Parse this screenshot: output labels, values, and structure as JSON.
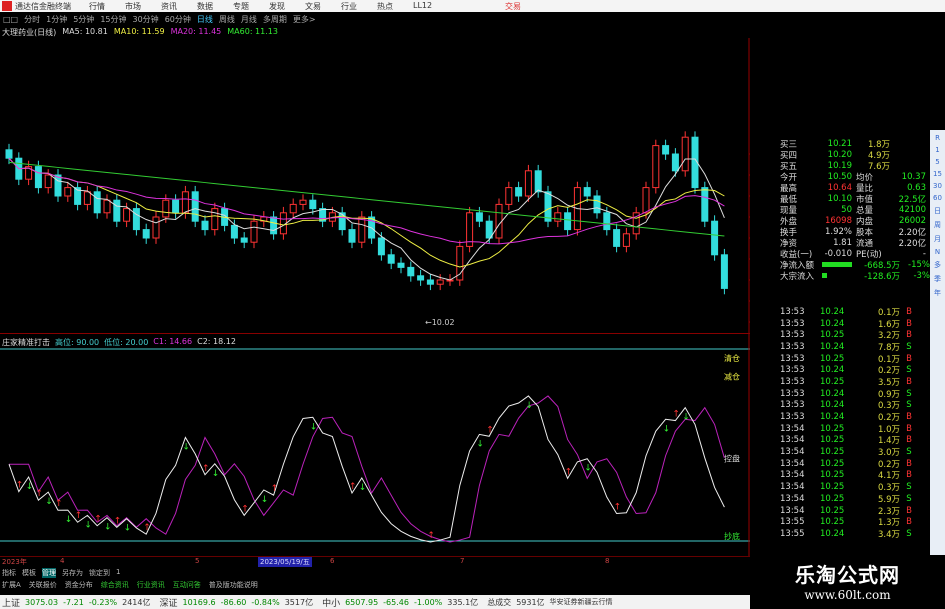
{
  "titlebar": {
    "app": "通达信金融终端",
    "menu": [
      "行情",
      "市场",
      "资讯",
      "数据",
      "专题",
      "发现",
      "文易",
      "行业",
      "热点",
      "LL12"
    ],
    "trade": "交易"
  },
  "periods": [
    "□□",
    "分时",
    "1分钟",
    "5分钟",
    "15分钟",
    "30分钟",
    "60分钟",
    "日线",
    "周线",
    "月线",
    "多周期",
    "更多>"
  ],
  "active_period": "日线",
  "main_header": {
    "name": "大理药业(日线)",
    "ma5": "MA5: 10.81",
    "ma10": "MA10: 11.59",
    "ma20": "MA20: 11.45",
    "ma60": "MA60: 11.13"
  },
  "main_axis": [
    "12.00",
    "11.75",
    "11.50",
    "11.25",
    "11.00",
    "10.75",
    "10.50",
    "10.25",
    "10.00"
  ],
  "low_label": "←10.02",
  "closes": [
    11.95,
    11.7,
    11.85,
    11.6,
    11.75,
    11.5,
    11.6,
    11.4,
    11.55,
    11.3,
    11.45,
    11.2,
    11.35,
    11.1,
    11.0,
    11.25,
    11.45,
    11.3,
    11.55,
    11.2,
    11.1,
    11.35,
    11.15,
    11.0,
    10.95,
    11.2,
    11.25,
    11.05,
    11.3,
    11.4,
    11.45,
    11.35,
    11.2,
    11.3,
    11.1,
    10.95,
    11.25,
    11.0,
    10.8,
    10.7,
    10.65,
    10.55,
    10.5,
    10.45,
    10.5,
    10.5,
    10.9,
    11.3,
    11.2,
    11.0,
    11.4,
    11.6,
    11.5,
    11.8,
    11.55,
    11.2,
    11.3,
    11.1,
    11.6,
    11.5,
    11.3,
    11.1,
    10.9,
    11.05,
    11.3,
    11.6,
    12.1,
    12.0,
    11.8,
    12.2,
    11.6,
    11.2,
    10.8,
    10.4
  ],
  "sub_header": {
    "name": "庄家精准打击",
    "high": "高位: 90.00",
    "low": "低位: 20.00",
    "c1": "C1: 14.66",
    "c2": "C2: 18.12"
  },
  "sub_axis": [
    "90.00",
    "80.00",
    "70.00",
    "60.00",
    "50.00",
    "40.00",
    "30.00",
    "20.00"
  ],
  "sub_labels": {
    "top": "清仓",
    "reduce": "减仓",
    "control": "控盘",
    "bottom": "抄底"
  },
  "quote": [
    [
      "买三",
      "10.21",
      "1.8万"
    ],
    [
      "买四",
      "10.20",
      "4.9万"
    ],
    [
      "买五",
      "10.19",
      "7.6万"
    ],
    [
      "今开",
      "10.50",
      "均价",
      "10.37"
    ],
    [
      "最高",
      "10.64",
      "量比",
      "0.63"
    ],
    [
      "最低",
      "10.10",
      "市值",
      "22.5亿"
    ],
    [
      "现量",
      "50",
      "总量",
      "42100"
    ],
    [
      "外盘",
      "16098",
      "内盘",
      "26002"
    ],
    [
      "换手",
      "1.92%",
      "股本",
      "2.20亿"
    ],
    [
      "净资",
      "1.81",
      "流通",
      "2.20亿"
    ],
    [
      "收益(一)",
      "-0.010",
      "PE(动)",
      "-"
    ]
  ],
  "flow": [
    [
      "净流入额",
      "-668.5万",
      "-15%"
    ],
    [
      "大宗流入",
      "-128.6万",
      "-3%"
    ]
  ],
  "ticks": [
    [
      "13:53",
      "10.24",
      "0.1万",
      "B"
    ],
    [
      "13:53",
      "10.24",
      "1.6万",
      "B"
    ],
    [
      "13:53",
      "10.25",
      "3.2万",
      "B"
    ],
    [
      "13:53",
      "10.24",
      "7.8万",
      "S"
    ],
    [
      "13:53",
      "10.25",
      "0.1万",
      "B"
    ],
    [
      "13:53",
      "10.24",
      "0.2万",
      "S"
    ],
    [
      "13:53",
      "10.25",
      "3.5万",
      "B"
    ],
    [
      "13:53",
      "10.24",
      "0.9万",
      "S"
    ],
    [
      "13:53",
      "10.24",
      "0.3万",
      "S"
    ],
    [
      "13:53",
      "10.24",
      "0.2万",
      "B"
    ],
    [
      "13:54",
      "10.25",
      "1.0万",
      "B"
    ],
    [
      "13:54",
      "10.25",
      "1.4万",
      "B"
    ],
    [
      "13:54",
      "10.25",
      "3.0万",
      "S"
    ],
    [
      "13:54",
      "10.25",
      "0.2万",
      "B"
    ],
    [
      "13:54",
      "10.25",
      "4.1万",
      "B"
    ],
    [
      "13:54",
      "10.25",
      "0.3万",
      "S"
    ],
    [
      "13:54",
      "10.25",
      "5.9万",
      "S"
    ],
    [
      "13:54",
      "10.25",
      "2.3万",
      "B"
    ],
    [
      "13:55",
      "10.25",
      "1.3万",
      "B"
    ],
    [
      "13:55",
      "10.24",
      "3.4万",
      "S"
    ]
  ],
  "toolcol": [
    "R",
    "1",
    "5",
    "15",
    "30",
    "60",
    "日",
    "周",
    "月",
    "N",
    "多",
    "季",
    "年"
  ],
  "datebar": [
    "2023年",
    "4",
    "5",
    "2023/05/19/五",
    "6",
    "7",
    "8"
  ],
  "tabs1": [
    "指标",
    "模板",
    "管理",
    "另存为",
    "锁定到",
    "1"
  ],
  "tabs2": [
    "扩展A",
    "关联报价",
    "资金分布",
    "综合资讯",
    "行业资讯",
    "互动问答",
    "普及版功能说明"
  ],
  "status": [
    [
      "上证",
      "3075.03",
      "-7.21",
      "-0.23%",
      "2414亿"
    ],
    [
      "深证",
      "10169.6",
      "-86.60",
      "-0.84%",
      "3517亿"
    ],
    [
      "中小",
      "6507.95",
      "-65.46",
      "-1.00%",
      "335.1亿"
    ]
  ],
  "total": [
    "总成交",
    "5931亿"
  ],
  "broker": "华安证券新疆云行情",
  "watermark": {
    "title": "乐淘公式网",
    "url": "www.60lt.com"
  }
}
